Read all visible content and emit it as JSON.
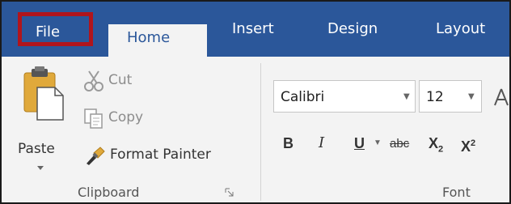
{
  "tabs": {
    "file": "File",
    "home": "Home",
    "insert": "Insert",
    "design": "Design",
    "layout": "Layout"
  },
  "clipboard": {
    "paste": "Paste",
    "cut": "Cut",
    "copy": "Copy",
    "format_painter": "Format Painter",
    "group_label": "Clipboard"
  },
  "font": {
    "font_name": "Calibri",
    "font_size": "12",
    "bold": "B",
    "italic": "I",
    "underline": "U",
    "strikethrough": "abc",
    "subscript": "X",
    "subscript_sub": "2",
    "superscript": "X",
    "superscript_sup": "2",
    "group_label": "Font"
  },
  "colors": {
    "ribbon_blue": "#2b579a",
    "file_highlight": "#b0151c",
    "ribbon_bg": "#f3f3f3"
  },
  "icons": [
    "paste-icon",
    "cut-icon",
    "copy-icon",
    "format-painter-icon",
    "dialog-launcher-icon",
    "dropdown-icon"
  ]
}
